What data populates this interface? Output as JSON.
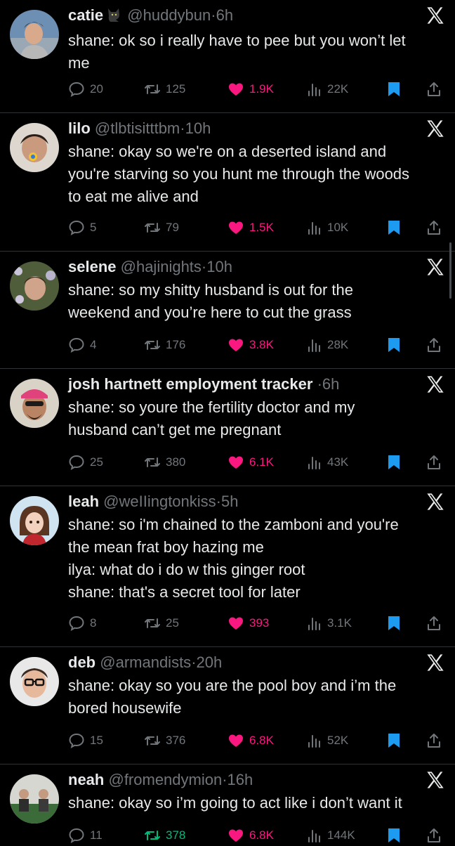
{
  "colors": {
    "background": "#000000",
    "text": "#e7e9ea",
    "muted": "#71767b",
    "like": "#f91880",
    "retweet_active": "#00ba7c",
    "bookmark": "#1d9bf0",
    "divider": "#2f3336"
  },
  "tweets": [
    {
      "name": "catie",
      "name_badge": "cat-emoji-icon",
      "handle": "@huddybun",
      "sep": "·",
      "time": "6h",
      "lines": [
        "shane: ok so i really have to pee but you won’t let",
        "me"
      ],
      "replies": "20",
      "retweets": "125",
      "likes": "1.9K",
      "views": "22K"
    },
    {
      "name": "lilo",
      "handle": "@tlbtisitttbm",
      "sep": "·",
      "time": "10h",
      "lines": [
        "shane: okay so we're on a deserted island and",
        "you're starving so you hunt me through the woods",
        "to eat me alive and"
      ],
      "replies": "5",
      "retweets": "79",
      "likes": "1.5K",
      "views": "10K"
    },
    {
      "name": "selene",
      "handle": "@hajinights",
      "sep": "·",
      "time": "10h",
      "lines": [
        "shane: so my shitty husband is out for the",
        "weekend and you’re here to cut the grass"
      ],
      "replies": "4",
      "retweets": "176",
      "likes": "3.8K",
      "views": "28K"
    },
    {
      "name": "josh hartnett employment tracker",
      "handle": "",
      "sep": "·",
      "time": "6h",
      "lines": [
        "shane: so youre the fertility doctor and my",
        "husband can’t get me pregnant"
      ],
      "replies": "25",
      "retweets": "380",
      "likes": "6.1K",
      "views": "43K"
    },
    {
      "name": "leah",
      "handle": "@weIIingtonkiss",
      "sep": "·",
      "time": "5h",
      "lines": [
        "shane: so i'm chained to the zamboni and you're",
        "the mean frat boy hazing me",
        "ilya: what do i do w this ginger root",
        "shane: that's  a secret tool for later"
      ],
      "replies": "8",
      "retweets": "25",
      "likes": "393",
      "views": "3.1K"
    },
    {
      "name": "deb",
      "handle": "@armandists",
      "sep": "·",
      "time": "20h",
      "lines": [
        "shane: okay so you are the pool boy and i’m the",
        "bored housewife"
      ],
      "replies": "15",
      "retweets": "376",
      "likes": "6.8K",
      "views": "52K"
    },
    {
      "name": "neah",
      "handle": "@fromendymion",
      "sep": "·",
      "time": "16h",
      "lines": [
        "shane: okay so i’m going to act like i don’t want it"
      ],
      "replies": "11",
      "retweets": "378",
      "retweeted": true,
      "likes": "6.8K",
      "views": "144K"
    }
  ]
}
